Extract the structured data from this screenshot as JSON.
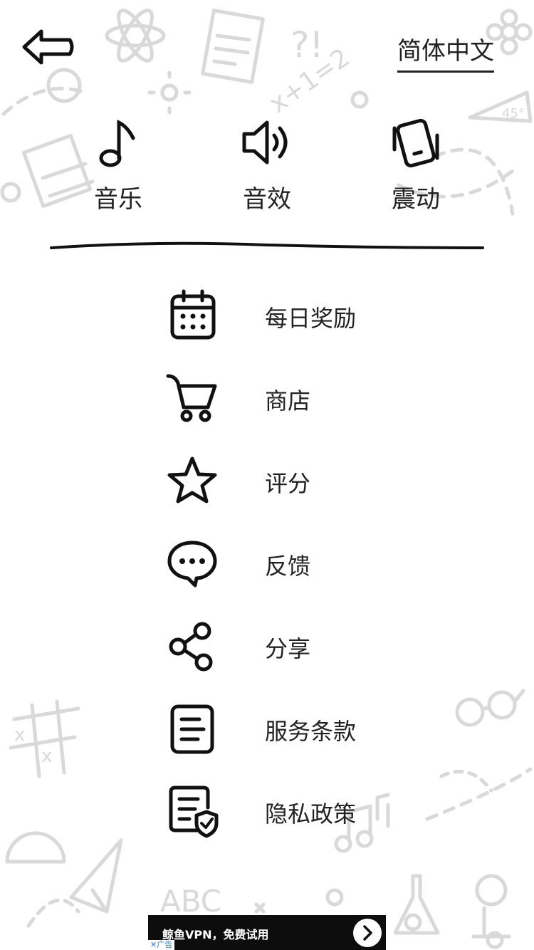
{
  "header": {
    "back_icon": "back-arrow-icon",
    "language_label": "简体中文"
  },
  "toggles": [
    {
      "label": "音乐",
      "icon": "music-note-icon"
    },
    {
      "label": "音效",
      "icon": "speaker-icon"
    },
    {
      "label": "震动",
      "icon": "vibration-icon"
    }
  ],
  "menu": [
    {
      "label": "每日奖励",
      "icon": "calendar-icon"
    },
    {
      "label": "商店",
      "icon": "shopping-cart-icon"
    },
    {
      "label": "评分",
      "icon": "star-icon"
    },
    {
      "label": "反馈",
      "icon": "chat-bubble-icon"
    },
    {
      "label": "分享",
      "icon": "share-icon"
    },
    {
      "label": "服务条款",
      "icon": "document-icon"
    },
    {
      "label": "隐私政策",
      "icon": "privacy-shield-icon"
    }
  ],
  "ad": {
    "text": "鲸鱼VPN，免费试用",
    "close_label": "✕广告"
  },
  "colors": {
    "background": "#ffffff",
    "ink": "#111111",
    "doodle": "#d9d9d9",
    "ad_background": "#0d0d0d"
  }
}
